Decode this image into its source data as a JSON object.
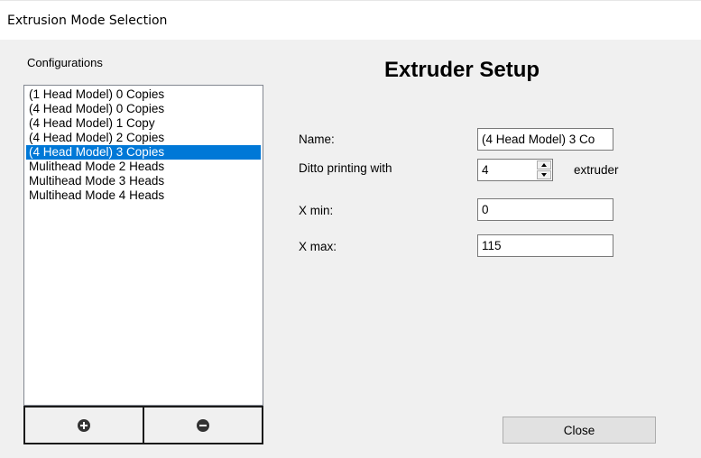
{
  "window": {
    "title": "Extrusion Mode Selection"
  },
  "configurations": {
    "label": "Configurations",
    "items": [
      {
        "label": "(1 Head Model) 0 Copies"
      },
      {
        "label": "(4 Head Model) 0 Copies"
      },
      {
        "label": "(4 Head Model) 1 Copy"
      },
      {
        "label": "(4 Head Model) 2 Copies"
      },
      {
        "label": "(4 Head Model) 3 Copies"
      },
      {
        "label": "Mulithead Mode 2 Heads"
      },
      {
        "label": "Multihead Mode 3 Heads"
      },
      {
        "label": "Multihead Mode 4 Heads"
      }
    ],
    "selected_index": 4,
    "add_icon": "plus-circle-icon",
    "remove_icon": "minus-circle-icon"
  },
  "setup": {
    "title": "Extruder Setup",
    "name_label": "Name:",
    "name_value": "(4 Head Model) 3 Co",
    "ditto_label": "Ditto printing with",
    "ditto_value": "4",
    "ditto_suffix": "extruder",
    "xmin_label": "X min:",
    "xmin_value": "0",
    "xmax_label": "X max:",
    "xmax_value": "115"
  },
  "close_label": "Close",
  "colors": {
    "selection": "#0078d7",
    "client_background": "#f0f0f0"
  }
}
